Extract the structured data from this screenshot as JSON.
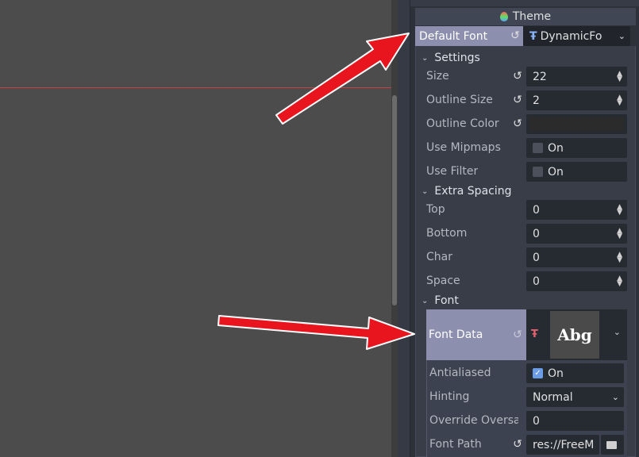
{
  "theme_header": {
    "label": "Theme"
  },
  "default_font": {
    "label": "Default Font",
    "value": "DynamicFo"
  },
  "settings": {
    "label": "Settings",
    "size": {
      "label": "Size",
      "value": "22"
    },
    "outline_size": {
      "label": "Outline Size",
      "value": "2"
    },
    "outline_color": {
      "label": "Outline Color",
      "color": "#2b2b2b"
    },
    "use_mipmaps": {
      "label": "Use Mipmaps",
      "value": "On"
    },
    "use_filter": {
      "label": "Use Filter",
      "value": "On"
    }
  },
  "extra_spacing": {
    "label": "Extra Spacing",
    "top": {
      "label": "Top",
      "value": "0"
    },
    "bottom": {
      "label": "Bottom",
      "value": "0"
    },
    "char": {
      "label": "Char",
      "value": "0"
    },
    "space": {
      "label": "Space",
      "value": "0"
    }
  },
  "font": {
    "label": "Font",
    "font_data": {
      "label": "Font Data",
      "preview": "Abg"
    },
    "antialiased": {
      "label": "Antialiased",
      "value": "On"
    },
    "hinting": {
      "label": "Hinting",
      "value": "Normal"
    },
    "override_oversampling": {
      "label": "Override Oversa",
      "value": "0"
    },
    "font_path": {
      "label": "Font Path",
      "value": "res://FreeM"
    }
  },
  "colors": {
    "arrow": "#e8141e",
    "highlight": "#8d8fae",
    "accent": "#6c9ce8"
  }
}
